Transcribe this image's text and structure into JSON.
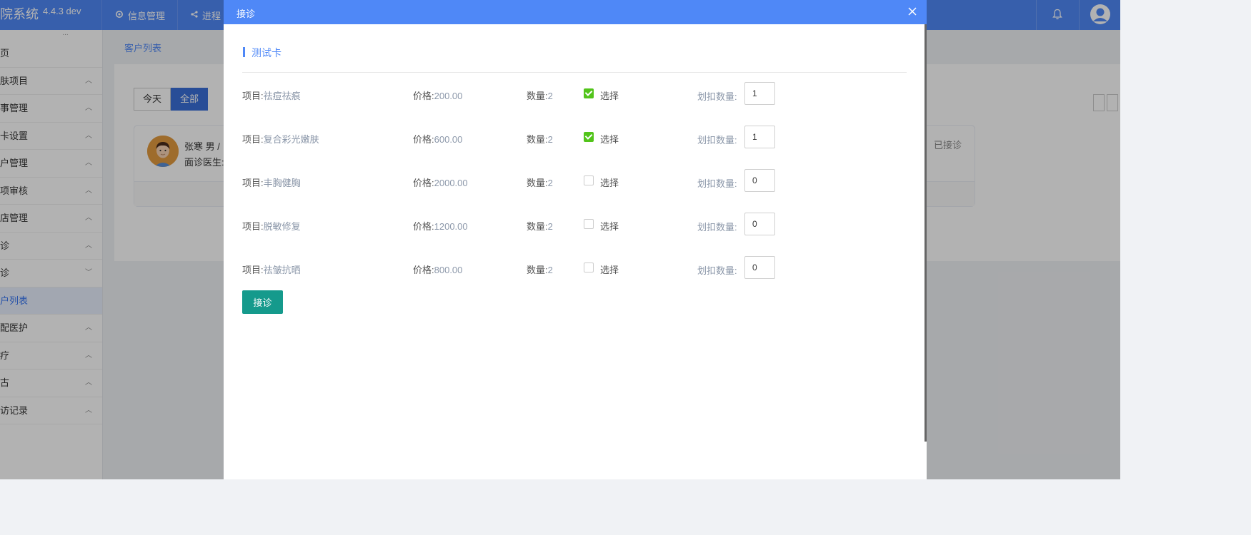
{
  "app": {
    "brand": "院系统",
    "version": "4.4.3 dev",
    "nav": [
      {
        "label": "信息管理",
        "icon": "settings-icon"
      },
      {
        "label": "进程",
        "icon": "share-icon"
      }
    ]
  },
  "sidebar": {
    "dots": "...",
    "items": [
      {
        "label": "页",
        "arrow": ""
      },
      {
        "label": "肤项目",
        "arrow": "︿"
      },
      {
        "label": "事管理",
        "arrow": "︿"
      },
      {
        "label": "卡设置",
        "arrow": "︿"
      },
      {
        "label": "户管理",
        "arrow": "︿"
      },
      {
        "label": "项审核",
        "arrow": "︿"
      },
      {
        "label": "店管理",
        "arrow": "︿"
      },
      {
        "label": "诊",
        "arrow": "︿"
      },
      {
        "label": "诊",
        "arrow": "﹀"
      },
      {
        "label": "户列表",
        "arrow": ""
      },
      {
        "label": "配医护",
        "arrow": "︿"
      },
      {
        "label": "疗",
        "arrow": "︿"
      },
      {
        "label": "古",
        "arrow": "︿"
      },
      {
        "label": "访记录",
        "arrow": "︿"
      }
    ]
  },
  "main": {
    "breadcrumb": "客户列表",
    "filter": {
      "today": "今天",
      "all": "全部"
    },
    "customer": {
      "name_line": "张寒 男 /",
      "doctor_line": "面诊医生:",
      "status": "已接诊"
    }
  },
  "modal": {
    "title": "接诊",
    "card_title": "测试卡",
    "labels": {
      "item": "项目:",
      "price": "价格:",
      "count": "数量:",
      "select": "选择",
      "deduct": "划扣数量:"
    },
    "rows": [
      {
        "item": "祛痘祛痕",
        "price": "200.00",
        "count": "2",
        "selected": true,
        "deduct": "1"
      },
      {
        "item": "复合彩光嫩肤",
        "price": "600.00",
        "count": "2",
        "selected": true,
        "deduct": "1"
      },
      {
        "item": "丰胸健胸",
        "price": "2000.00",
        "count": "2",
        "selected": false,
        "deduct": "0"
      },
      {
        "item": "脱敏修复",
        "price": "1200.00",
        "count": "2",
        "selected": false,
        "deduct": "0"
      },
      {
        "item": "祛皱抗晒",
        "price": "800.00",
        "count": "2",
        "selected": false,
        "deduct": "0"
      }
    ],
    "submit_label": "接诊"
  },
  "colors": {
    "primary": "#4f88f7",
    "submit": "#159a8c",
    "checked": "#52c41a"
  }
}
